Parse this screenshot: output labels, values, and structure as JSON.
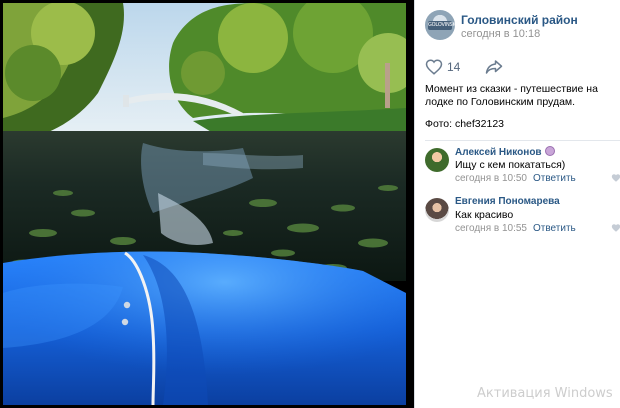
{
  "post": {
    "author_name": "Головинский район",
    "author_date": "сегодня в 10:18",
    "avatar_text": "GOLOVINSKY",
    "likes": "14",
    "text": "Момент из сказки - путешествие на лодке по Головинским прудам.",
    "photo_credit": "Фото: chef32123"
  },
  "comments": [
    {
      "name": "Алексей Никонов",
      "text": "Ищу с кем покататься)",
      "date": "сегодня в 10:50",
      "reply": "Ответить"
    },
    {
      "name": "Евгения Пономарева",
      "text": "Как красиво",
      "date": "сегодня в 10:55",
      "reply": "Ответить"
    }
  ],
  "watermark": "Активация Windows",
  "colors": {
    "link": "#2a5885",
    "meta": "#939393",
    "boat": "#1f6fe8",
    "backdrop": "#000000"
  },
  "icons": [
    "heart-icon",
    "share-icon"
  ]
}
